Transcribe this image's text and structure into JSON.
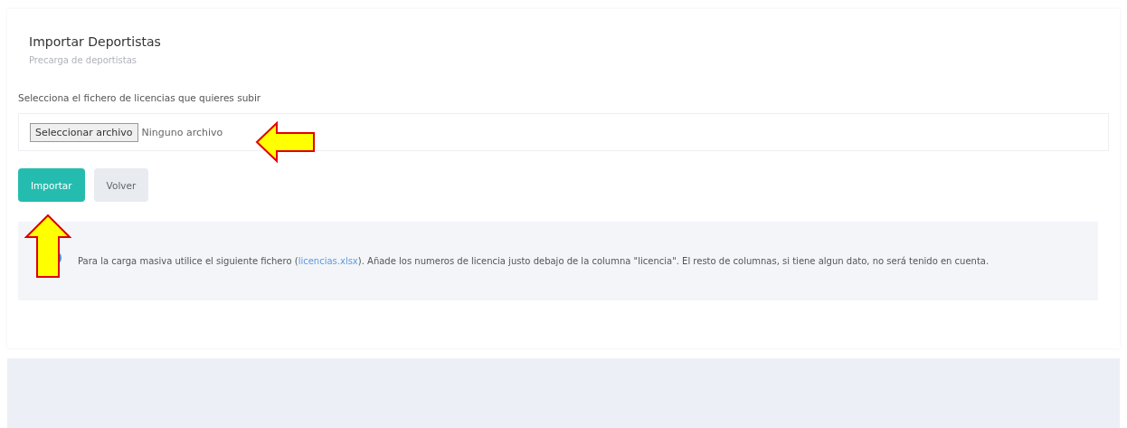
{
  "card": {
    "title": "Importar Deportistas",
    "subtitle": "Precarga de deportistas"
  },
  "file_input": {
    "label": "Selecciona el fichero de licencias que quieres subir",
    "button": "Seleccionar archivo",
    "status": "Ninguno archivo"
  },
  "buttons": [
    {
      "label": "Importar",
      "kind": "primary"
    },
    {
      "label": "Volver",
      "kind": "secondary"
    }
  ],
  "info": {
    "text_before": "Para la carga masiva utilice el siguiente fichero (",
    "link": "licencias.xlsx",
    "text_after": "). Añade los numeros de licencia justo debajo de la columna \"licencia\". El resto de columnas, si tiene algun dato, no será tenido en cuenta."
  }
}
